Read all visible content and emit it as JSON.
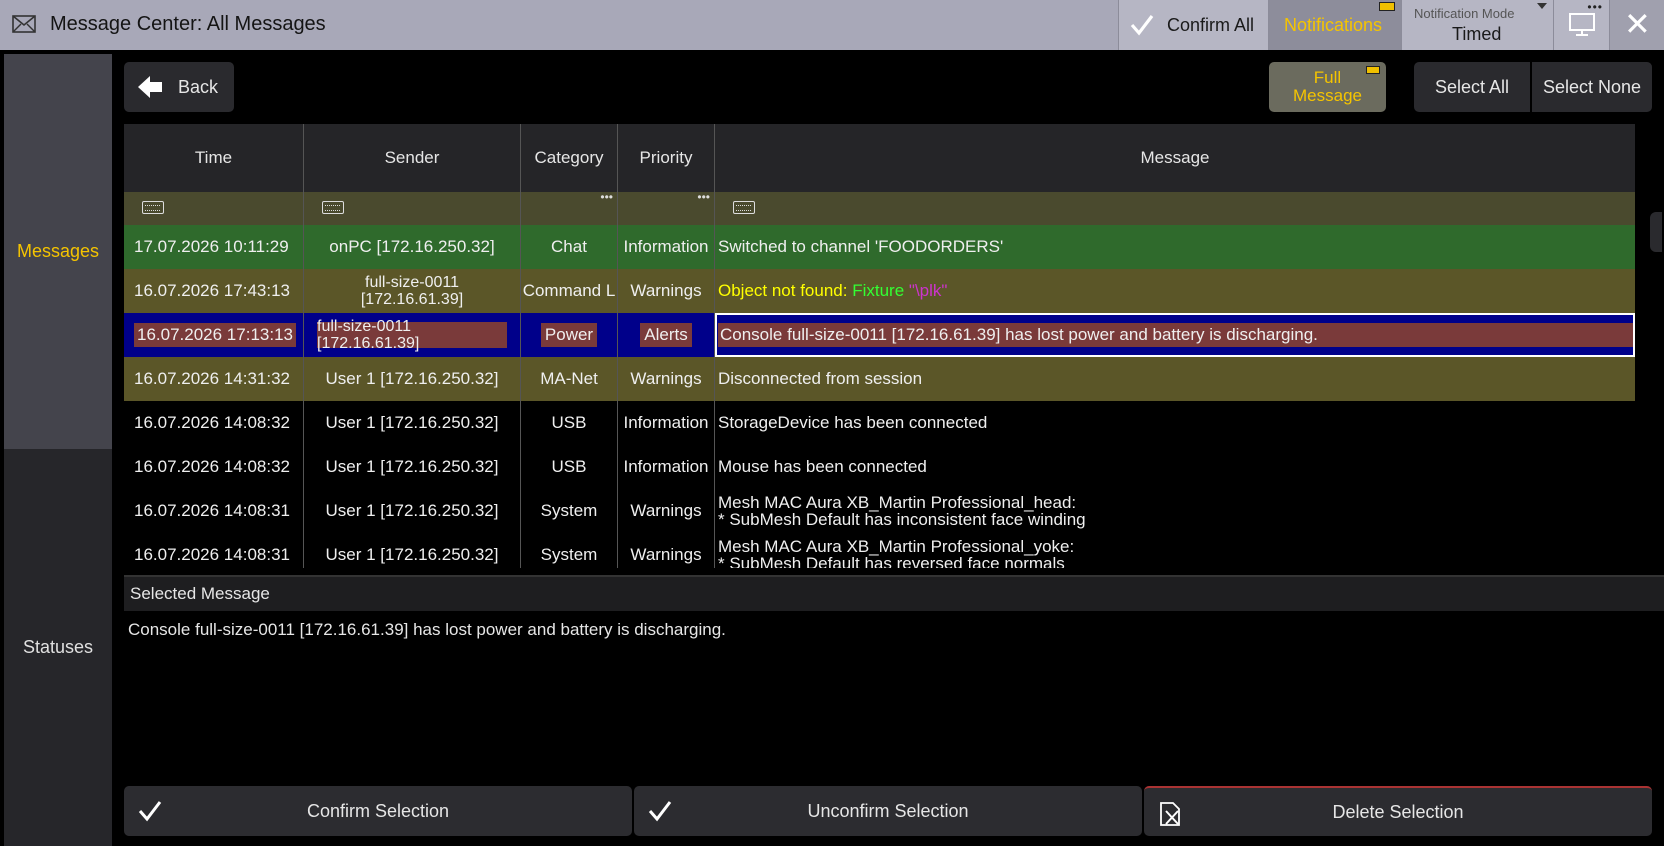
{
  "titlebar": {
    "title": "Message Center: All Messages",
    "confirm_all": "Confirm All",
    "notifications": "Notifications",
    "notification_mode_caption": "Notification Mode",
    "notification_mode_value": "Timed"
  },
  "sidebar": {
    "tabs": [
      {
        "label": "Messages",
        "active": true
      },
      {
        "label": "Statuses",
        "active": false
      }
    ]
  },
  "toolbar": {
    "back": "Back",
    "full_message_line1": "Full",
    "full_message_line2": "Message",
    "select_all": "Select All",
    "select_none": "Select None"
  },
  "table": {
    "columns": [
      "Time",
      "Sender",
      "Category",
      "Priority",
      "Message"
    ],
    "rows": [
      {
        "time": "17.07.2026 10:11:29",
        "sender": "onPC [172.16.250.32]",
        "category": "Chat",
        "priority": "Information",
        "message": "Switched to channel 'FOODORDERS'"
      },
      {
        "time": "16.07.2026 17:43:13",
        "sender_line1": "full-size-0011",
        "sender_line2": "[172.16.61.39]",
        "category": "Command L",
        "priority": "Warnings",
        "message_part1": "Object not found: ",
        "message_part2": "Fixture ",
        "message_part3": "\"\\plk\""
      },
      {
        "time": "16.07.2026 17:13:13",
        "sender_line1": "full-size-0011",
        "sender_line2": "[172.16.61.39]",
        "category": "Power",
        "priority": "Alerts",
        "message": "Console full-size-0011 [172.16.61.39] has lost power and battery is discharging."
      },
      {
        "time": "16.07.2026 14:31:32",
        "sender": "User 1 [172.16.250.32]",
        "category": "MA-Net",
        "priority": "Warnings",
        "message": "Disconnected from session"
      },
      {
        "time": "16.07.2026 14:08:32",
        "sender": "User 1 [172.16.250.32]",
        "category": "USB",
        "priority": "Information",
        "message": "StorageDevice has been connected"
      },
      {
        "time": "16.07.2026 14:08:32",
        "sender": "User 1 [172.16.250.32]",
        "category": "USB",
        "priority": "Information",
        "message": "Mouse has been connected"
      },
      {
        "time": "16.07.2026 14:08:31",
        "sender": "User 1 [172.16.250.32]",
        "category": "System",
        "priority": "Warnings",
        "message_line1": "Mesh MAC Aura XB_Martin Professional_head:",
        "message_line2": "* SubMesh Default has inconsistent face winding"
      },
      {
        "time": "16.07.2026 14:08:31",
        "sender": "User 1 [172.16.250.32]",
        "category": "System",
        "priority": "Warnings",
        "message_line1": "Mesh MAC Aura XB_Martin Professional_yoke:",
        "message_line2": "* SubMesh Default has reversed face normals"
      }
    ]
  },
  "selected": {
    "heading": "Selected Message",
    "text": "Console full-size-0011 [172.16.61.39] has lost power and battery is discharging."
  },
  "bottom": {
    "confirm": "Confirm Selection",
    "unconfirm": "Unconfirm Selection",
    "delete": "Delete Selection"
  },
  "colors": {
    "accent_yellow": "#f5c400",
    "row_chat": "#2f6a2c",
    "row_warning": "#5b5628",
    "row_selected": "#00008a",
    "alert_cell": "#7a3a3a"
  }
}
